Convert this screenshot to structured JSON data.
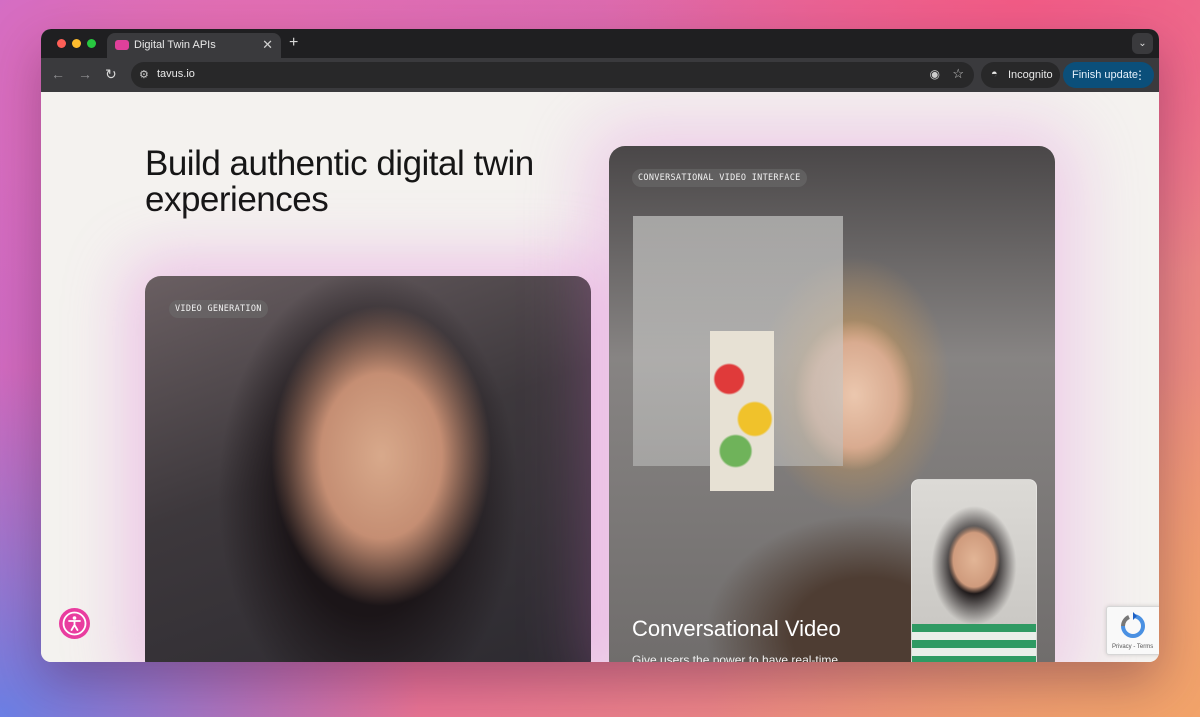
{
  "browser": {
    "tab_title": "Digital Twin APIs",
    "url": "tavus.io",
    "incognito_label": "Incognito",
    "update_label": "Finish update"
  },
  "page": {
    "headline": "Build authentic digital twin experiences",
    "cards": [
      {
        "label": "VIDEO GENERATION"
      },
      {
        "label": "CONVERSATIONAL VIDEO INTERFACE",
        "title": "Conversational Video",
        "description": "Give users the power to have real-time"
      }
    ]
  },
  "recaptcha": {
    "links": "Privacy - Terms"
  },
  "colors": {
    "accent": "#e93c9f",
    "update_button": "#0b4f7a"
  }
}
